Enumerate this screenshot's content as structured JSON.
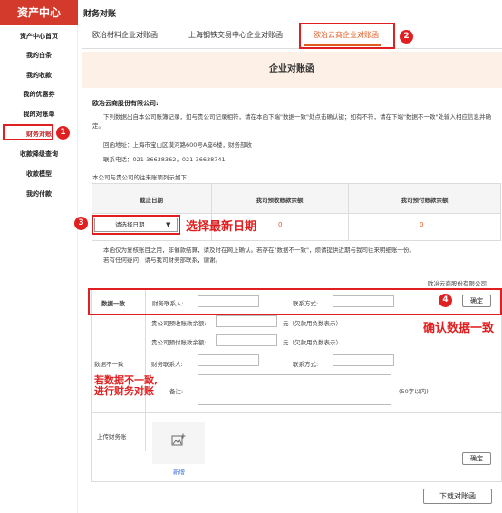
{
  "sidebar": {
    "title": "资产中心",
    "items": [
      {
        "label": "资产中心首页"
      },
      {
        "label": "我的白条"
      },
      {
        "label": "我的收款"
      },
      {
        "label": "我的优惠券"
      },
      {
        "label": "我的对账单"
      },
      {
        "label": "财务对账"
      },
      {
        "label": "收款降级查询"
      },
      {
        "label": "收款模型"
      },
      {
        "label": "我的付款"
      }
    ]
  },
  "header": {
    "title": "财务对账"
  },
  "tabs": [
    {
      "label": "欧冶材料企业对账函"
    },
    {
      "label": "上海钢铁交易中心企业对账函"
    },
    {
      "label": "欧冶云商企业对账函"
    }
  ],
  "banner": {
    "title": "企业对账函"
  },
  "letter": {
    "addressee": "欧冶云商股份有限公司:",
    "body": "下列数据出自本公司账簿记录，如与贵公司记录相符，请在本函下端\"数据一致\"处点击确认键；如有不符，请在下端\"数据不一致\"处输入相应信息并确定。",
    "address": "回函地址：上海市宝山区漠河路600号A座6楼，财务部收",
    "phone": "联系电话：021-36638362，021-36638741",
    "intro": "本公司与贵公司的往来账项列示如下："
  },
  "table": {
    "headers": [
      "截止日期",
      "我司预收账款余额",
      "我司预付账款余额"
    ],
    "date_placeholder": "请选择日期",
    "receivable": "0",
    "payable": "0"
  },
  "notes": {
    "line1": "本函仅为复核账目之用，非催款结算，请及时在网上确认。若存在\"数据不一致\"，烦请提供近期与我司往来明细账一份。",
    "line2": "若有任何疑问，请与我司财务部联系，谢谢。",
    "signature": "欧冶云商股份有限公司"
  },
  "consistent": {
    "label": "数据一致",
    "contact_label": "财务联系人:",
    "contact_value": "",
    "method_label": "联系方式:",
    "method_value": "",
    "confirm": "确定"
  },
  "inconsistent": {
    "label": "数据不一致",
    "advance_recv_label": "贵公司预收账款余额:",
    "advance_recv_value": "",
    "advance_recv_unit": "元（欠款用负数表示）",
    "advance_pay_label": "贵公司预付账款余额:",
    "advance_pay_value": "",
    "advance_pay_unit": "元（欠款用负数表示）",
    "contact_label": "财务联系人:",
    "contact_value": "",
    "method_label": "联系方式:",
    "method_value": "",
    "remark_label": "备注:",
    "remark_value": "",
    "remark_hint": "(50字以内)",
    "confirm": "确定"
  },
  "upload": {
    "label": "上传财务账",
    "add": "新增"
  },
  "download": {
    "label": "下载对账函"
  },
  "annotations": {
    "n1": "1",
    "n2": "2",
    "n3": "3",
    "n4": "4",
    "select_latest": "选择最新日期",
    "confirm_consistent": "确认数据一致",
    "if_inconsistent_1": "若数据不一致,",
    "if_inconsistent_2": "进行财务对账"
  },
  "colors": {
    "accent": "#d43a2c",
    "annotation": "#e02020",
    "banner_bg": "#fdf0e6",
    "active_tab": "#e05a1e"
  }
}
